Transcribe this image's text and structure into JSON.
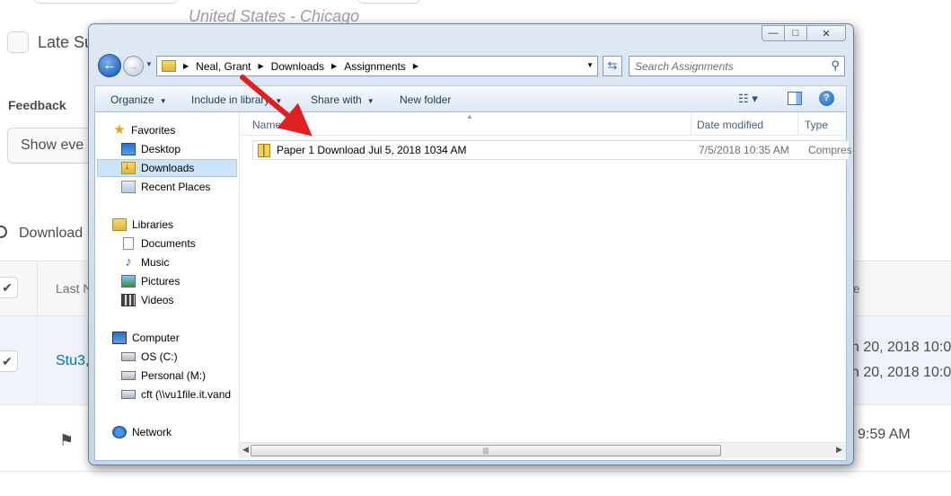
{
  "background": {
    "location": "United States - Chicago",
    "late_label": "Late Su",
    "feedback_label": "Feedback",
    "feedback_select": "Show eve",
    "download_label": "Download",
    "table": {
      "last_name_header": "Last N",
      "date_header": "te",
      "student_link": "Stu3,",
      "date_line1": "n 20, 2018 10:0",
      "date_line2": "n 20, 2018 10:0",
      "time_row2": "9:59 AM"
    }
  },
  "dialog": {
    "window_buttons": {
      "minimize": "—",
      "maximize": "□",
      "close": "✕"
    },
    "address": {
      "crumbs": [
        "Neal, Grant",
        "Downloads",
        "Assignments"
      ]
    },
    "search": {
      "placeholder": "Search Assignments"
    },
    "toolbar": {
      "organize": "Organize",
      "include_in_library": "Include in library",
      "share_with": "Share with",
      "new_folder": "New folder"
    },
    "nav_pane": {
      "favorites": "Favorites",
      "desktop": "Desktop",
      "downloads": "Downloads",
      "recent_places": "Recent Places",
      "libraries": "Libraries",
      "documents": "Documents",
      "music": "Music",
      "pictures": "Pictures",
      "videos": "Videos",
      "computer": "Computer",
      "os_c": "OS (C:)",
      "personal_m": "Personal (M:)",
      "cft": "cft (\\\\vu1file.it.vand",
      "network": "Network"
    },
    "columns": {
      "name": "Name",
      "date_modified": "Date modified",
      "type": "Type"
    },
    "files": [
      {
        "name": "Paper 1 Download Jul 5, 2018 1034 AM",
        "date_modified": "7/5/2018 10:35 AM",
        "type": "Compres"
      }
    ]
  },
  "colors": {
    "annotation_arrow": "#e02020",
    "link": "#006fbf",
    "selection": "#cde3f8"
  }
}
